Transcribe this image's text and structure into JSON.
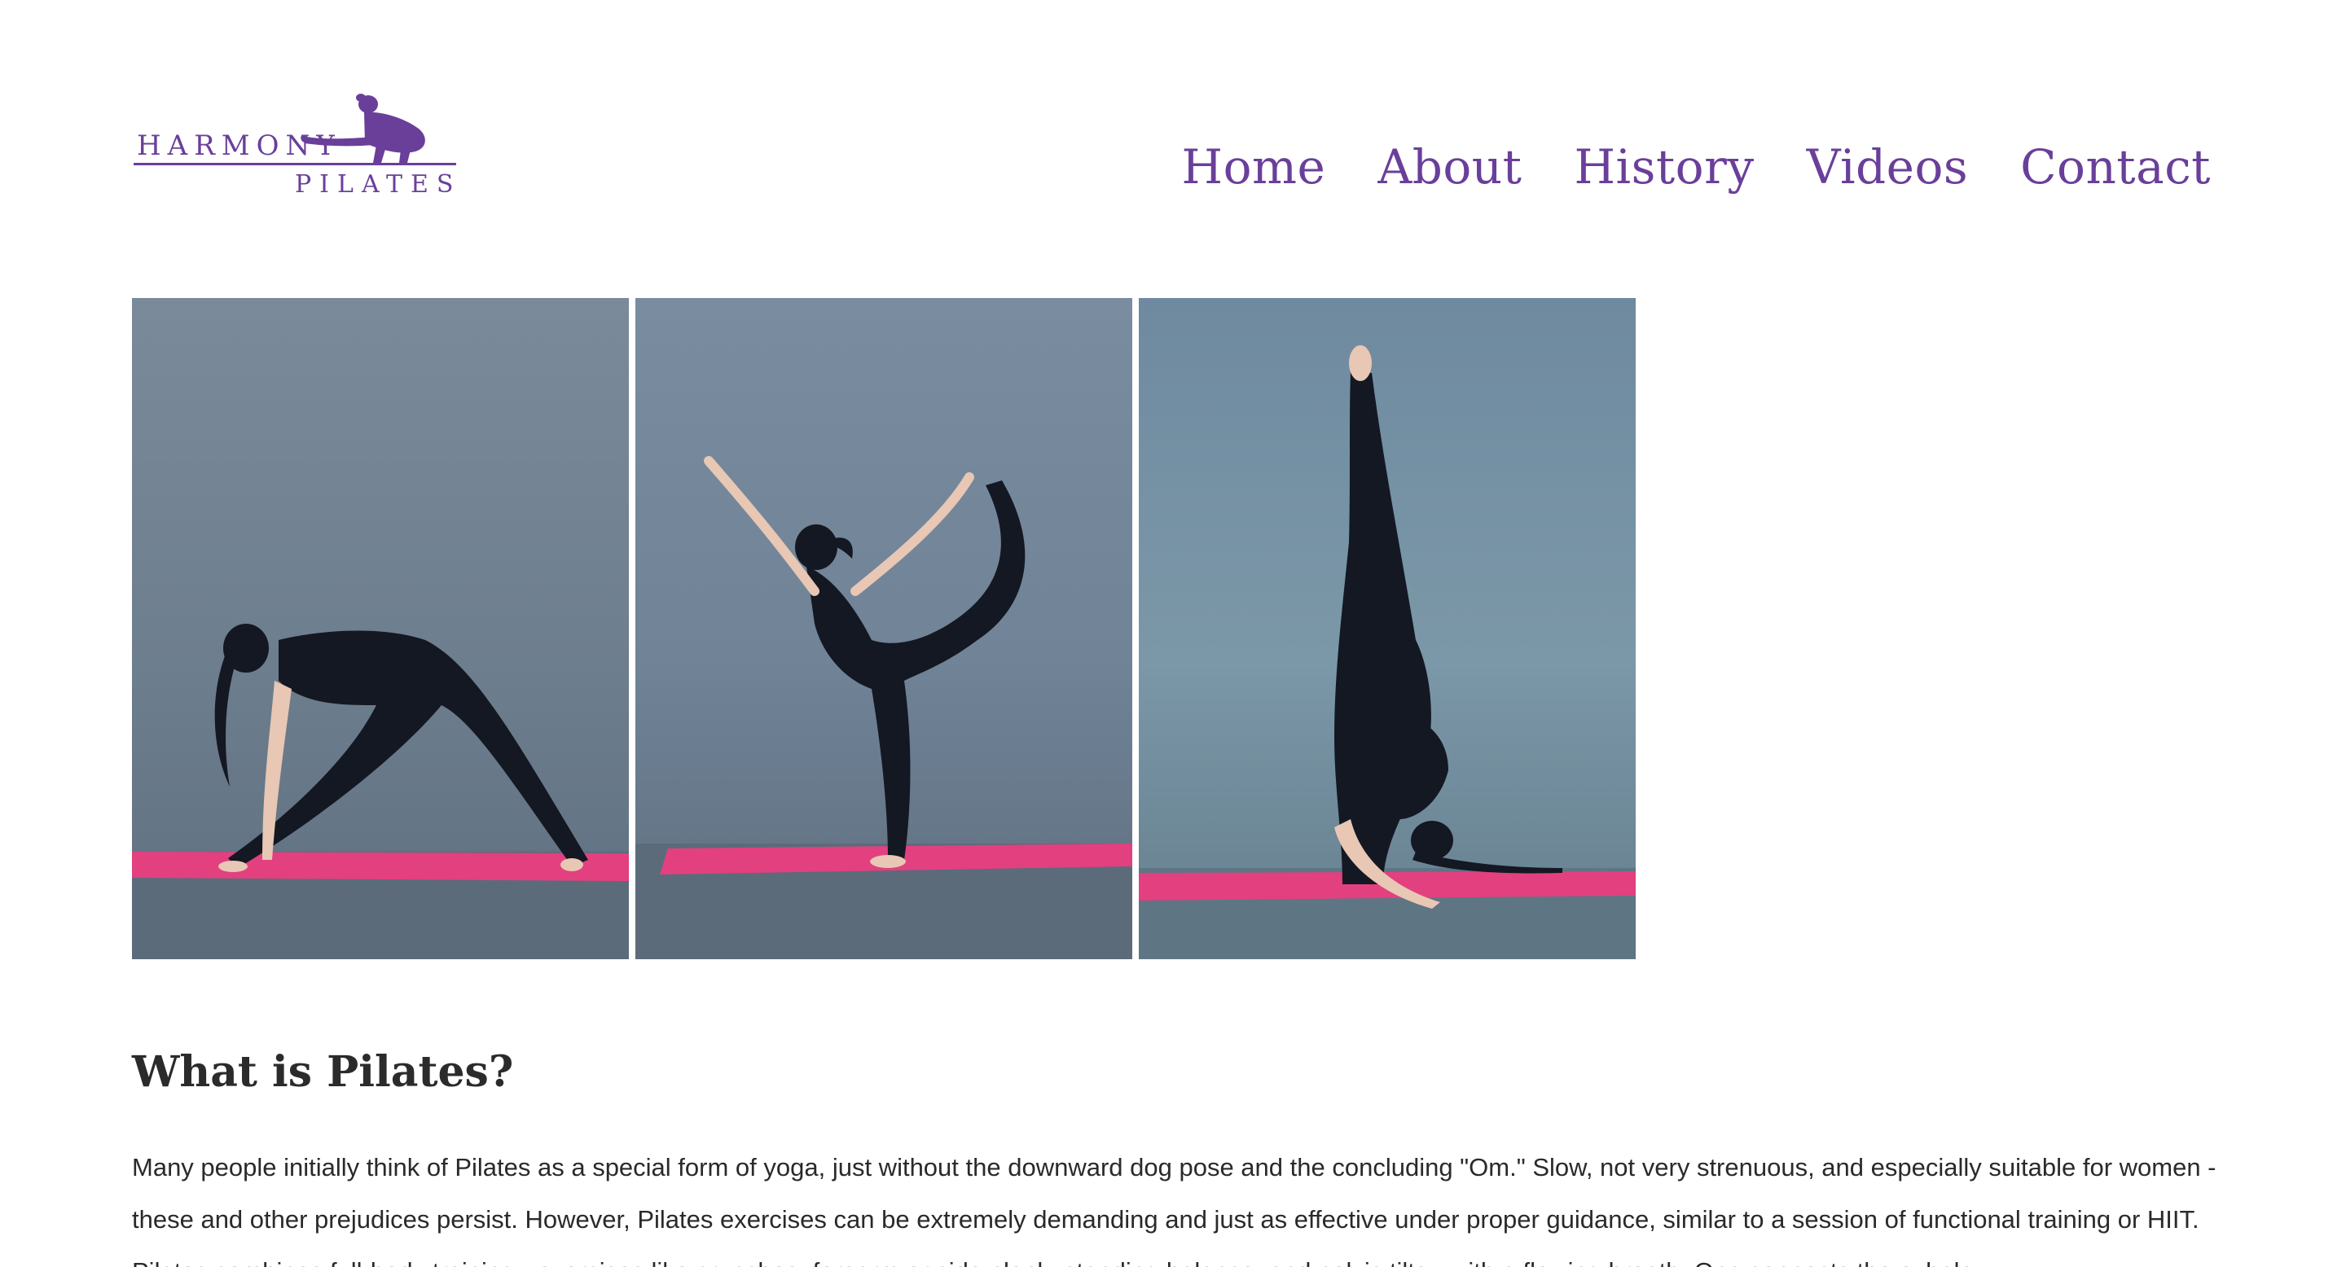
{
  "brand": {
    "line1": "HARMONY",
    "line2": "PILATES",
    "color": "#6a3f9a"
  },
  "nav": {
    "items": [
      {
        "label": "Home"
      },
      {
        "label": "About"
      },
      {
        "label": "History"
      },
      {
        "label": "Videos"
      },
      {
        "label": "Contact"
      }
    ]
  },
  "gallery": {
    "images": [
      {
        "subject": "triangle-pose-photo"
      },
      {
        "subject": "dancer-pose-photo"
      },
      {
        "subject": "standing-split-photo"
      }
    ],
    "mat_color": "#e2407f",
    "backdrop_color": "#6f8293"
  },
  "article": {
    "heading": "What is Pilates?",
    "paragraph": "Many people initially think of Pilates as a special form of yoga, just without the downward dog pose and the concluding \"Om.\" Slow, not very strenuous, and especially suitable for women - these and other prejudices persist. However, Pilates exercises can be extremely demanding and just as effective under proper guidance, similar to a session of functional training or HIIT. Pilates combines full-body training - exercises like crunches, forearm or side plank, standing balance, and pelvic tilts - with a flowing breath. One connects the exhale"
  }
}
